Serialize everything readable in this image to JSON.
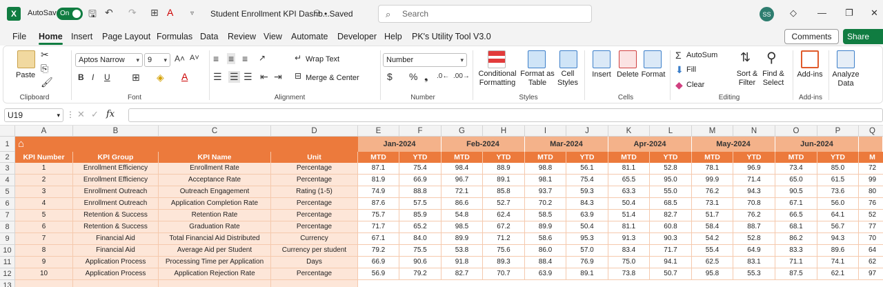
{
  "titlebar": {
    "app_logo": "X",
    "autosave_label": "AutoSave",
    "autosave_state": "On",
    "document_title": "Student Enrollment KPI Dashb...",
    "saved_status": "• Saved",
    "search_placeholder": "Search",
    "user_initials": "SS"
  },
  "menu": {
    "tabs": [
      "File",
      "Home",
      "Insert",
      "Page Layout",
      "Formulas",
      "Data",
      "Review",
      "View",
      "Automate",
      "Developer",
      "Help",
      "PK's Utility Tool V3.0"
    ],
    "active_tab": "Home",
    "comments_label": "Comments",
    "share_label": "Share"
  },
  "ribbon": {
    "clipboard": {
      "paste": "Paste",
      "label": "Clipboard"
    },
    "font": {
      "name": "Aptos Narrow",
      "size": "9",
      "label": "Font"
    },
    "alignment": {
      "wrap_text": "Wrap Text",
      "merge_center": "Merge & Center",
      "label": "Alignment"
    },
    "number": {
      "format": "Number",
      "label": "Number"
    },
    "styles": {
      "conditional_1": "Conditional",
      "conditional_2": "Formatting",
      "format_table_1": "Format as",
      "format_table_2": "Table",
      "cell_styles_1": "Cell",
      "cell_styles_2": "Styles",
      "label": "Styles"
    },
    "cells": {
      "insert": "Insert",
      "delete": "Delete",
      "format": "Format",
      "label": "Cells"
    },
    "editing": {
      "autosum": "AutoSum",
      "fill": "Fill",
      "clear": "Clear",
      "sort_1": "Sort &",
      "sort_2": "Filter",
      "find_1": "Find &",
      "find_2": "Select",
      "label": "Editing"
    },
    "addins": {
      "button": "Add-ins",
      "label": "Add-ins"
    },
    "analyze": {
      "line1": "Analyze",
      "line2": "Data"
    }
  },
  "formula_bar": {
    "name_box": "U19",
    "fx": "fx"
  },
  "grid": {
    "columns": [
      "A",
      "B",
      "C",
      "D",
      "E",
      "F",
      "G",
      "H",
      "I",
      "J",
      "K",
      "L",
      "M",
      "N",
      "O",
      "P",
      "Q"
    ],
    "row_numbers": [
      "1",
      "2",
      "3",
      "4",
      "5",
      "6",
      "7",
      "8",
      "9",
      "10",
      "11",
      "12",
      "13"
    ],
    "months": [
      "Jan-2024",
      "Feb-2024",
      "Mar-2024",
      "Apr-2024",
      "May-2024",
      "Jun-2024"
    ],
    "headers": [
      "KPI Number",
      "KPI Group",
      "KPI Name",
      "Unit"
    ],
    "sub_headers": [
      "MTD",
      "YTD",
      "MTD",
      "YTD",
      "MTD",
      "YTD",
      "MTD",
      "YTD",
      "MTD",
      "YTD",
      "MTD",
      "YTD",
      "M"
    ],
    "rows": [
      {
        "num": "1",
        "group": "Enrollment Efficiency",
        "name": "Enrollment Rate",
        "unit": "Percentage",
        "values": [
          "87.1",
          "75.4",
          "98.4",
          "88.9",
          "98.8",
          "56.1",
          "81.1",
          "52.8",
          "78.1",
          "96.9",
          "73.4",
          "85.0",
          "72"
        ]
      },
      {
        "num": "2",
        "group": "Enrollment Efficiency",
        "name": "Acceptance Rate",
        "unit": "Percentage",
        "values": [
          "81.9",
          "66.9",
          "96.7",
          "89.1",
          "98.1",
          "75.4",
          "65.5",
          "95.0",
          "99.9",
          "71.4",
          "65.0",
          "61.5",
          "99"
        ]
      },
      {
        "num": "3",
        "group": "Enrollment Outreach",
        "name": "Outreach Engagement",
        "unit": "Rating (1-5)",
        "values": [
          "74.9",
          "88.8",
          "72.1",
          "85.8",
          "93.7",
          "59.3",
          "63.3",
          "55.0",
          "76.2",
          "94.3",
          "90.5",
          "73.6",
          "80"
        ]
      },
      {
        "num": "4",
        "group": "Enrollment Outreach",
        "name": "Application Completion Rate",
        "unit": "Percentage",
        "values": [
          "87.6",
          "57.5",
          "86.6",
          "52.7",
          "70.2",
          "84.3",
          "50.4",
          "68.5",
          "73.1",
          "70.8",
          "67.1",
          "56.0",
          "76"
        ]
      },
      {
        "num": "5",
        "group": "Retention & Success",
        "name": "Retention Rate",
        "unit": "Percentage",
        "values": [
          "75.7",
          "85.9",
          "54.8",
          "62.4",
          "58.5",
          "63.9",
          "51.4",
          "82.7",
          "51.7",
          "76.2",
          "66.5",
          "64.1",
          "52"
        ]
      },
      {
        "num": "6",
        "group": "Retention & Success",
        "name": "Graduation Rate",
        "unit": "Percentage",
        "values": [
          "71.7",
          "65.2",
          "98.5",
          "67.2",
          "89.9",
          "50.4",
          "81.1",
          "60.8",
          "58.4",
          "88.7",
          "68.1",
          "56.7",
          "77"
        ]
      },
      {
        "num": "7",
        "group": "Financial Aid",
        "name": "Total Financial Aid Distributed",
        "unit": "Currency",
        "values": [
          "67.1",
          "84.0",
          "89.9",
          "71.2",
          "58.6",
          "95.3",
          "91.3",
          "90.3",
          "54.2",
          "52.8",
          "86.2",
          "94.3",
          "70"
        ]
      },
      {
        "num": "8",
        "group": "Financial Aid",
        "name": "Average Aid per Student",
        "unit": "Currency per student",
        "values": [
          "79.2",
          "75.5",
          "53.8",
          "75.6",
          "86.0",
          "57.0",
          "83.4",
          "71.7",
          "55.4",
          "64.9",
          "83.3",
          "89.6",
          "64"
        ]
      },
      {
        "num": "9",
        "group": "Application Process",
        "name": "Processing Time per Application",
        "unit": "Days",
        "values": [
          "66.9",
          "90.6",
          "91.8",
          "89.3",
          "88.4",
          "76.9",
          "75.0",
          "94.1",
          "62.5",
          "83.1",
          "71.1",
          "74.1",
          "62"
        ]
      },
      {
        "num": "10",
        "group": "Application Process",
        "name": "Application Rejection Rate",
        "unit": "Percentage",
        "values": [
          "56.9",
          "79.2",
          "82.7",
          "70.7",
          "63.9",
          "89.1",
          "73.8",
          "50.7",
          "95.8",
          "55.3",
          "87.5",
          "62.1",
          "97"
        ]
      }
    ]
  },
  "colors": {
    "excel_green": "#107c41",
    "header_orange": "#ec7a3c",
    "month_peach": "#f4b28a",
    "info_fill": "#fde6d8"
  }
}
